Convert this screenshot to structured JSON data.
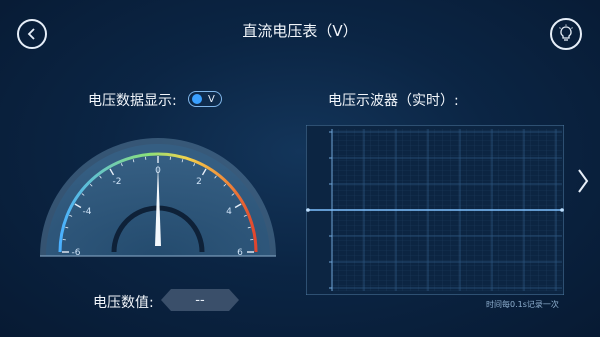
{
  "header": {
    "title": "直流电压表（V）"
  },
  "left": {
    "display_label": "电压数据显示:",
    "toggle_unit": "V",
    "value_label": "电压数值:",
    "value_text": "--"
  },
  "gauge": {
    "ticks": [
      "-6",
      "-4",
      "-2",
      "0",
      "2",
      "4",
      "6"
    ],
    "min": -6,
    "max": 6,
    "needle_value": 0
  },
  "right": {
    "title": "电压示波器（实时）:",
    "y_labels": [
      "6V",
      "4V",
      "2V",
      "0V",
      "-2V",
      "-4V",
      "-6V"
    ],
    "note": "时间每0.1s记录一次",
    "signal_value": 0
  },
  "colors": {
    "accent": "#3aa0ff",
    "background": "#0b2544"
  }
}
